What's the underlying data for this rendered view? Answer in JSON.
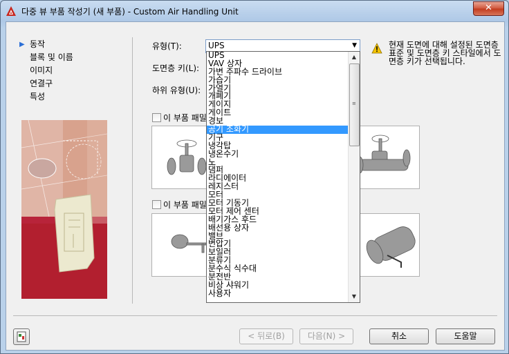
{
  "window": {
    "title": "다중 뷰 부품 작성기 (새 부품) - Custom Air Handling Unit",
    "close_glyph": "✕"
  },
  "nav": {
    "items": [
      {
        "label": "동작",
        "active": true
      },
      {
        "label": "블록 및 이름",
        "active": false
      },
      {
        "label": "이미지",
        "active": false
      },
      {
        "label": "연결구",
        "active": false
      },
      {
        "label": "특성",
        "active": false
      }
    ],
    "active_marker": "▶"
  },
  "form": {
    "type_label": "유형(T):",
    "type_value": "UPS",
    "layer_key_label": "도면층 키(L):",
    "subtype_label": "하위 유형(U):",
    "warning_text": "현재 도면에 대해 설정된 도면층 표준 및 도면층 키 스타일에서 도면층 키가 선택됩니다.",
    "checkbox1_label": "이 부품 패밀",
    "checkbox2_label": "이 부품 패밀"
  },
  "dropdown": {
    "items": [
      "UPS",
      "VAV 상자",
      "가변 주파수 드라이브",
      "가습기",
      "가열기",
      "개폐기",
      "게이지",
      "게이트",
      "경보",
      "공기 조화기",
      "기구",
      "냉각탑",
      "냉온수기",
      "노",
      "댐퍼",
      "라디에이터",
      "레지스터",
      "모터",
      "모터 기동기",
      "모터 제어 센터",
      "배기가스 후드",
      "배선용 상자",
      "밸브",
      "변압기",
      "보일러",
      "분류기",
      "분수식 식수대",
      "분전반",
      "비상 샤워기",
      "사용자"
    ],
    "selected": "공기 조화기",
    "scroll_up": "▲",
    "scroll_down": "▼"
  },
  "buttons": {
    "back": "< 뒤로(B)",
    "next": "다음(N) >",
    "cancel": "취소",
    "help": "도움말"
  },
  "colors": {
    "selection": "#3399ff",
    "accent_red": "#c0392b",
    "warning": "#f5c400"
  }
}
